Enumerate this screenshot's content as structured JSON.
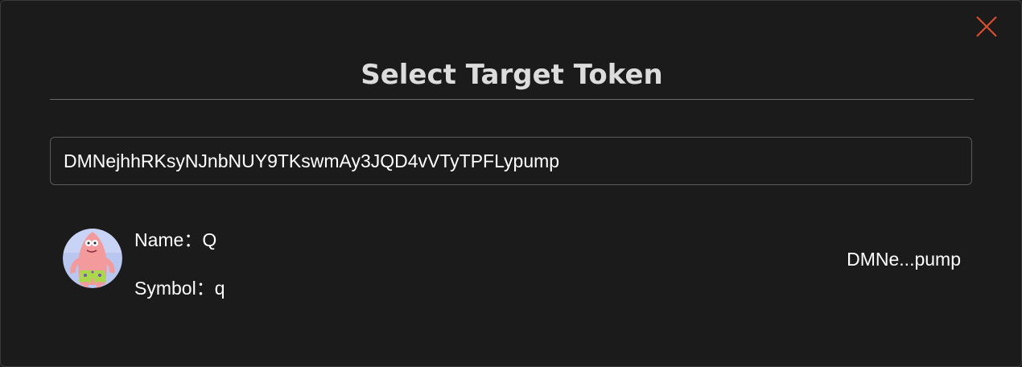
{
  "modal": {
    "title": "Select Target Token",
    "close_icon": "close-icon",
    "accent_color": "#e0502f"
  },
  "search": {
    "value": "DMNejhhRKsyNJnbNUY9TKswmAy3JQD4vVTyTPFLypump"
  },
  "results": [
    {
      "name_label": "Name：",
      "name": "Q",
      "symbol_label": "Symbol：",
      "symbol": "q",
      "address_short": "DMNe...pump",
      "avatar_icon": "token-avatar-icon"
    }
  ]
}
